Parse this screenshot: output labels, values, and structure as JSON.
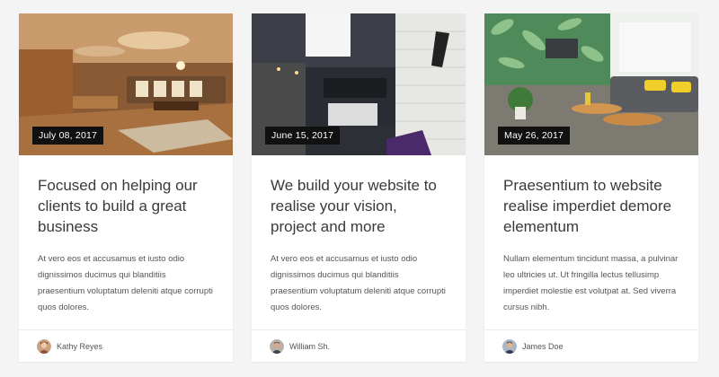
{
  "posts": [
    {
      "date": "July 08, 2017",
      "title": "Focused on helping our clients to build a great business",
      "excerpt": "At vero eos et accusamus et iusto odio dignissimos ducimus qui blanditiis praesentium voluptatum deleniti atque corrupti quos dolores.",
      "author": "Kathy Reyes",
      "image": "living-room-photo"
    },
    {
      "date": "June 15, 2017",
      "title": "We build your website to realise your vision, project and more",
      "excerpt": "At vero eos et accusamus et iusto odio dignissimos ducimus qui blanditiis praesentium voluptatum deleniti atque corrupti quos dolores.",
      "author": "William Sh.",
      "image": "cafe-interior-photo"
    },
    {
      "date": "May 26, 2017",
      "title": "Praesentium to website realise imperdiet demore elementum",
      "excerpt": "Nullam elementum tincidunt massa, a pulvinar leo ultricies ut. Ut fringilla lectus tellusimp imperdiet molestie est volutpat at. Sed viverra cursus nibh.",
      "author": "James Doe",
      "image": "lounge-room-photo"
    }
  ],
  "colors": {
    "page_background": "#f4f4f5",
    "card_background": "#ffffff",
    "date_badge": "#111111",
    "title_text": "#3a3a3a",
    "body_text": "#555555"
  }
}
